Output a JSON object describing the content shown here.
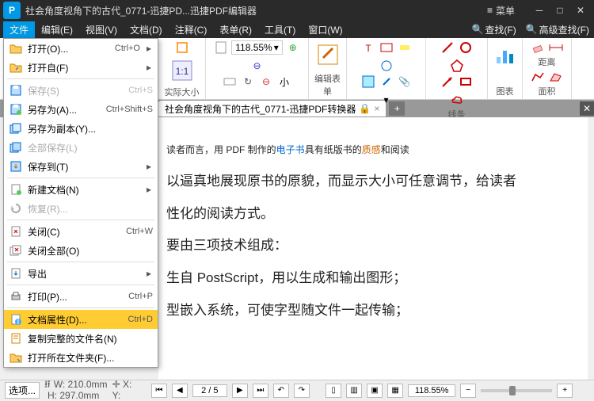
{
  "titlebar": {
    "title": "社会角度视角下的古代_0771-迅捷PD...迅捷PDF编辑器",
    "menu_label": "菜单"
  },
  "menubar": {
    "items": [
      "文件",
      "编辑(E)",
      "视图(V)",
      "文档(D)",
      "注释(C)",
      "表单(R)",
      "工具(T)",
      "窗口(W)"
    ],
    "find": "查找(F)",
    "adv_find": "高级查找(F)"
  },
  "ribbon": {
    "zoom_value": "118.55%",
    "zoom_drop": "▾",
    "group_actual": "实际大小",
    "group_edit": "编辑表单",
    "group_line": "线条",
    "group_chart": "图表",
    "group_dist": "距离",
    "group_area": "面积"
  },
  "tab": {
    "title": "社会角度视角下的古代_0771-迅捷PDF转换器"
  },
  "file_menu": {
    "items": [
      {
        "icon": "open",
        "label": "打开(O)...",
        "shortcut": "Ctrl+O",
        "arrow": true
      },
      {
        "icon": "openfrom",
        "label": "打开自(F)",
        "arrow": true
      },
      {
        "sep": true
      },
      {
        "icon": "save",
        "label": "保存(S)",
        "shortcut": "Ctrl+S",
        "disabled": true
      },
      {
        "icon": "saveas",
        "label": "另存为(A)...",
        "shortcut": "Ctrl+Shift+S"
      },
      {
        "icon": "savecopy",
        "label": "另存为副本(Y)..."
      },
      {
        "icon": "saveall",
        "label": "全部保存(L)",
        "disabled": true
      },
      {
        "icon": "saveto",
        "label": "保存到(T)",
        "arrow": true
      },
      {
        "sep": true
      },
      {
        "icon": "newdoc",
        "label": "新建文档(N)",
        "arrow": true
      },
      {
        "icon": "restore",
        "label": "恢复(R)...",
        "disabled": true
      },
      {
        "sep": true
      },
      {
        "icon": "close",
        "label": "关闭(C)",
        "shortcut": "Ctrl+W"
      },
      {
        "icon": "closeall",
        "label": "关闭全部(O)"
      },
      {
        "sep": true
      },
      {
        "icon": "export",
        "label": "导出",
        "arrow": true
      },
      {
        "sep": true
      },
      {
        "icon": "print",
        "label": "打印(P)...",
        "shortcut": "Ctrl+P"
      },
      {
        "sep": true
      },
      {
        "icon": "props",
        "label": "文档属性(D)...",
        "shortcut": "Ctrl+D",
        "highlighted": true
      },
      {
        "icon": "copyname",
        "label": "复制完整的文件名(N)"
      },
      {
        "icon": "openloc",
        "label": "打开所在文件夹(F)..."
      }
    ]
  },
  "doc": {
    "p1a": "读者而言，用 PDF 制作的",
    "p1b": "电子书",
    "p1c": "具有纸版书的",
    "p1d": "质感",
    "p1e": "和阅读",
    "p2": "以逼真地展现原书的原貌，而显示大小可任意调节，给读者",
    "p3": "性化的阅读方式。",
    "p4": "要由三项技术组成：",
    "p5": "生自 PostScript，用以生成和输出图形；",
    "p6": "型嵌入系统，可使字型随文件一起传输；"
  },
  "statusbar": {
    "options": "选项...",
    "w": "W: 210.0mm",
    "h": "H: 297.0mm",
    "x": "X:",
    "y": "Y:",
    "page": "2 / 5",
    "zoom": "118.55%"
  }
}
